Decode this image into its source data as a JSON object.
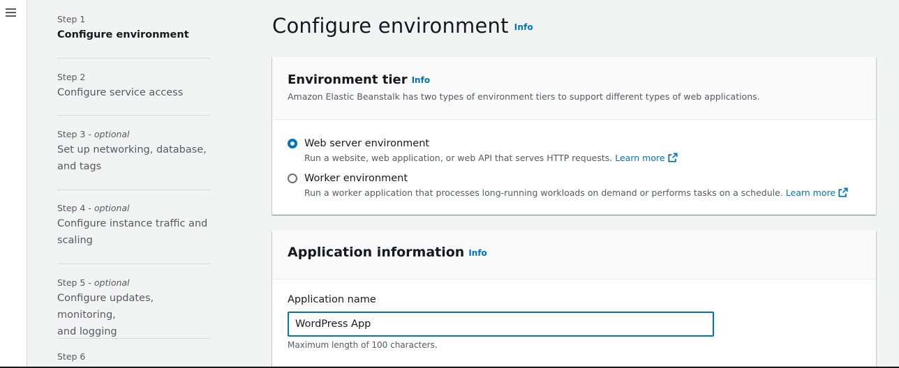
{
  "nav": {
    "menu_icon": "hamburger-menu-icon"
  },
  "steps": [
    {
      "number": "Step 1",
      "optional": "",
      "title": "Configure environment",
      "active": true
    },
    {
      "number": "Step 2",
      "optional": "",
      "title": "Configure service access",
      "active": false
    },
    {
      "number": "Step 3",
      "optional": "optional",
      "title_line1": "Set up networking, database,",
      "title_line2": "and tags",
      "active": false
    },
    {
      "number": "Step 4",
      "optional": "optional",
      "title_line1": "Configure instance traffic and",
      "title_line2": "scaling",
      "active": false
    },
    {
      "number": "Step 5",
      "optional": "optional",
      "title_line1": "Configure updates, monitoring,",
      "title_line2": "and logging",
      "active": false
    },
    {
      "number": "Step 6"
    }
  ],
  "step_optional_sep": " - ",
  "page": {
    "title": "Configure environment",
    "info": "Info"
  },
  "environment_tier": {
    "title": "Environment tier",
    "info": "Info",
    "description": "Amazon Elastic Beanstalk has two types of environment tiers to support different types of web applications.",
    "options": [
      {
        "label": "Web server environment",
        "description": "Run a website, web application, or web API that serves HTTP requests.",
        "learn_more": "Learn more",
        "checked": true
      },
      {
        "label": "Worker environment",
        "description": "Run a worker application that processes long-running workloads on demand or performs tasks on a schedule.",
        "learn_more": "Learn more",
        "checked": false
      }
    ]
  },
  "application_info": {
    "title": "Application information",
    "info": "Info",
    "name_label": "Application name",
    "name_value": "WordPress App",
    "name_hint": "Maximum length of 100 characters."
  },
  "colors": {
    "link": "#0073bb",
    "text": "#16191f",
    "muted": "#545b64",
    "background": "#f2f3f3"
  }
}
